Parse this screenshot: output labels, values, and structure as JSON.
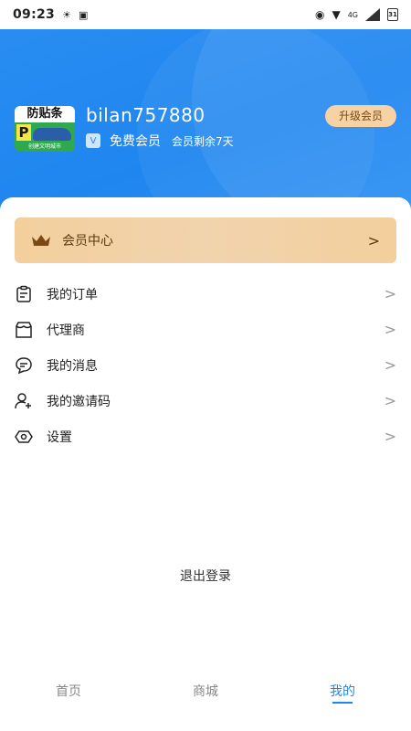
{
  "status_bar": {
    "time": "09:23",
    "network": "4G",
    "battery": "31"
  },
  "profile": {
    "avatar_text_top": "防贴条",
    "avatar_letter": "P",
    "avatar_text_bottom": "创建文明城市",
    "username": "bilan757880",
    "membership": "免费会员",
    "membership_remaining": "会员剩余7天",
    "upgrade_label": "升级会员"
  },
  "vip_center": {
    "label": "会员中心"
  },
  "menu": {
    "items": [
      {
        "label": "我的订单",
        "icon": "clipboard-icon"
      },
      {
        "label": "代理商",
        "icon": "shop-icon"
      },
      {
        "label": "我的消息",
        "icon": "chat-bubble-icon"
      },
      {
        "label": "我的邀请码",
        "icon": "user-add-icon"
      },
      {
        "label": "设置",
        "icon": "eye-settings-icon"
      }
    ]
  },
  "logout_label": "退出登录",
  "tabs": [
    {
      "label": "首页",
      "active": false
    },
    {
      "label": "商城",
      "active": false
    },
    {
      "label": "我的",
      "active": true
    }
  ],
  "colors": {
    "primary": "#1f86f0",
    "vip_gold": "#f3cf9d"
  }
}
